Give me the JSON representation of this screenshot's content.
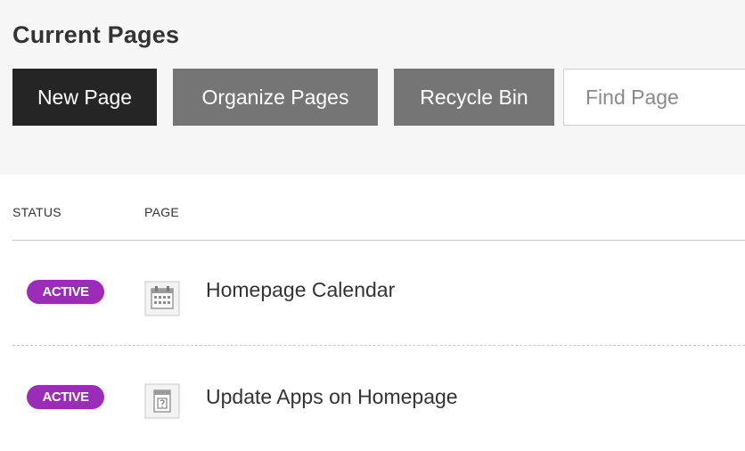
{
  "header": {
    "title": "Current Pages"
  },
  "toolbar": {
    "new_page_label": "New Page",
    "organize_label": "Organize Pages",
    "recycle_label": "Recycle Bin",
    "search_placeholder": "Find Page"
  },
  "table": {
    "columns": [
      "STATUS",
      "PAGE"
    ],
    "rows": [
      {
        "status": "ACTIVE",
        "icon": "calendar-icon",
        "name": "Homepage Calendar"
      },
      {
        "status": "ACTIVE",
        "icon": "document-icon",
        "name": "Update Apps on Homepage"
      }
    ]
  },
  "colors": {
    "active_badge": "#9b2cb8",
    "primary_button": "#252525",
    "secondary_button": "#757575",
    "panel_background": "#f6f6f6"
  }
}
